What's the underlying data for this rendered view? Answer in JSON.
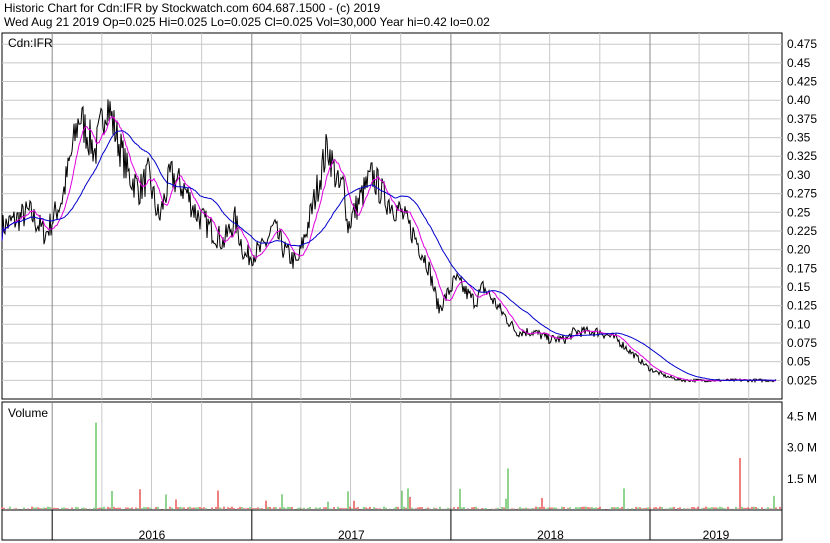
{
  "header": {
    "line1": "Historic Chart for Cdn:IFR by Stockwatch.com 604.687.1500 - (c) 2019",
    "line2": "Wed Aug 21 2019   Op=0.025   Hi=0.025   Lo=0.025   Cl=0.025   Vol=30,000   Year hi=0.42   lo=0.02"
  },
  "colors": {
    "price": "#000000",
    "ma_short": "#e000e0",
    "ma_long": "#0000cc",
    "vol_up": "#22aa22",
    "vol_down": "#dd0000",
    "grid": "#c8c8c8"
  },
  "chart_data": [
    {
      "type": "line",
      "title": "Cdn:IFR",
      "ylim": [
        0,
        0.49
      ],
      "y_ticks": [
        "0.475",
        "0.45",
        "0.425",
        "0.40",
        "0.375",
        "0.35",
        "0.325",
        "0.30",
        "0.275",
        "0.25",
        "0.225",
        "0.20",
        "0.175",
        "0.15",
        "0.125",
        "0.10",
        "0.075",
        "0.05",
        "0.025"
      ],
      "x_ticks": [
        "2016",
        "2017",
        "2018",
        "2019"
      ],
      "x_range": [
        "2015-10",
        "2019-08"
      ],
      "anchors_x": [
        "2015-10-01",
        "2015-11-20",
        "2015-12-20",
        "2016-01-20",
        "2016-02-20",
        "2016-03-20",
        "2016-04-10",
        "2016-04-25",
        "2016-05-20",
        "2016-06-10",
        "2016-06-25",
        "2016-07-15",
        "2016-08-05",
        "2016-09-01",
        "2016-09-20",
        "2016-10-15",
        "2016-11-10",
        "2016-12-01",
        "2016-12-20",
        "2017-01-20",
        "2017-02-10",
        "2017-03-01",
        "2017-03-25",
        "2017-04-20",
        "2017-05-20",
        "2017-06-10",
        "2017-06-20",
        "2017-06-25",
        "2017-07-20",
        "2017-08-10",
        "2017-09-01",
        "2017-10-01",
        "2017-10-25",
        "2017-11-20",
        "2017-12-10",
        "2018-01-10",
        "2018-02-01",
        "2018-02-15",
        "2018-03-01",
        "2018-04-01",
        "2018-05-01",
        "2018-06-01",
        "2018-07-01",
        "2018-08-01",
        "2018-08-15",
        "2018-09-10",
        "2018-10-01",
        "2018-11-01",
        "2018-12-01",
        "2019-01-01",
        "2019-02-01",
        "2019-03-01",
        "2019-04-01",
        "2019-05-01",
        "2019-06-01",
        "2019-07-01",
        "2019-08-01",
        "2019-08-21"
      ],
      "anchors_y": [
        0.23,
        0.25,
        0.22,
        0.27,
        0.38,
        0.33,
        0.4,
        0.36,
        0.3,
        0.28,
        0.3,
        0.24,
        0.3,
        0.28,
        0.25,
        0.23,
        0.21,
        0.24,
        0.19,
        0.2,
        0.23,
        0.2,
        0.18,
        0.25,
        0.34,
        0.28,
        0.29,
        0.23,
        0.27,
        0.3,
        0.27,
        0.25,
        0.22,
        0.18,
        0.12,
        0.16,
        0.14,
        0.13,
        0.15,
        0.12,
        0.09,
        0.09,
        0.08,
        0.08,
        0.09,
        0.09,
        0.09,
        0.08,
        0.06,
        0.04,
        0.03,
        0.025,
        0.025,
        0.025,
        0.025,
        0.025,
        0.025,
        0.025
      ],
      "series": []
    },
    {
      "type": "bar",
      "title": "Volume",
      "ylim": [
        0,
        5000000
      ],
      "y_ticks": [
        "4.5 M",
        "3.0 M",
        "1.5 M"
      ],
      "spikes_x": [
        "2016-03-20",
        "2017-05-20",
        "2016-06-10",
        "2018-04-15",
        "2019-06-15"
      ],
      "spikes_value": [
        4200000,
        400000,
        1000000,
        2000000,
        2500000
      ],
      "baseline_value": 150000
    }
  ]
}
